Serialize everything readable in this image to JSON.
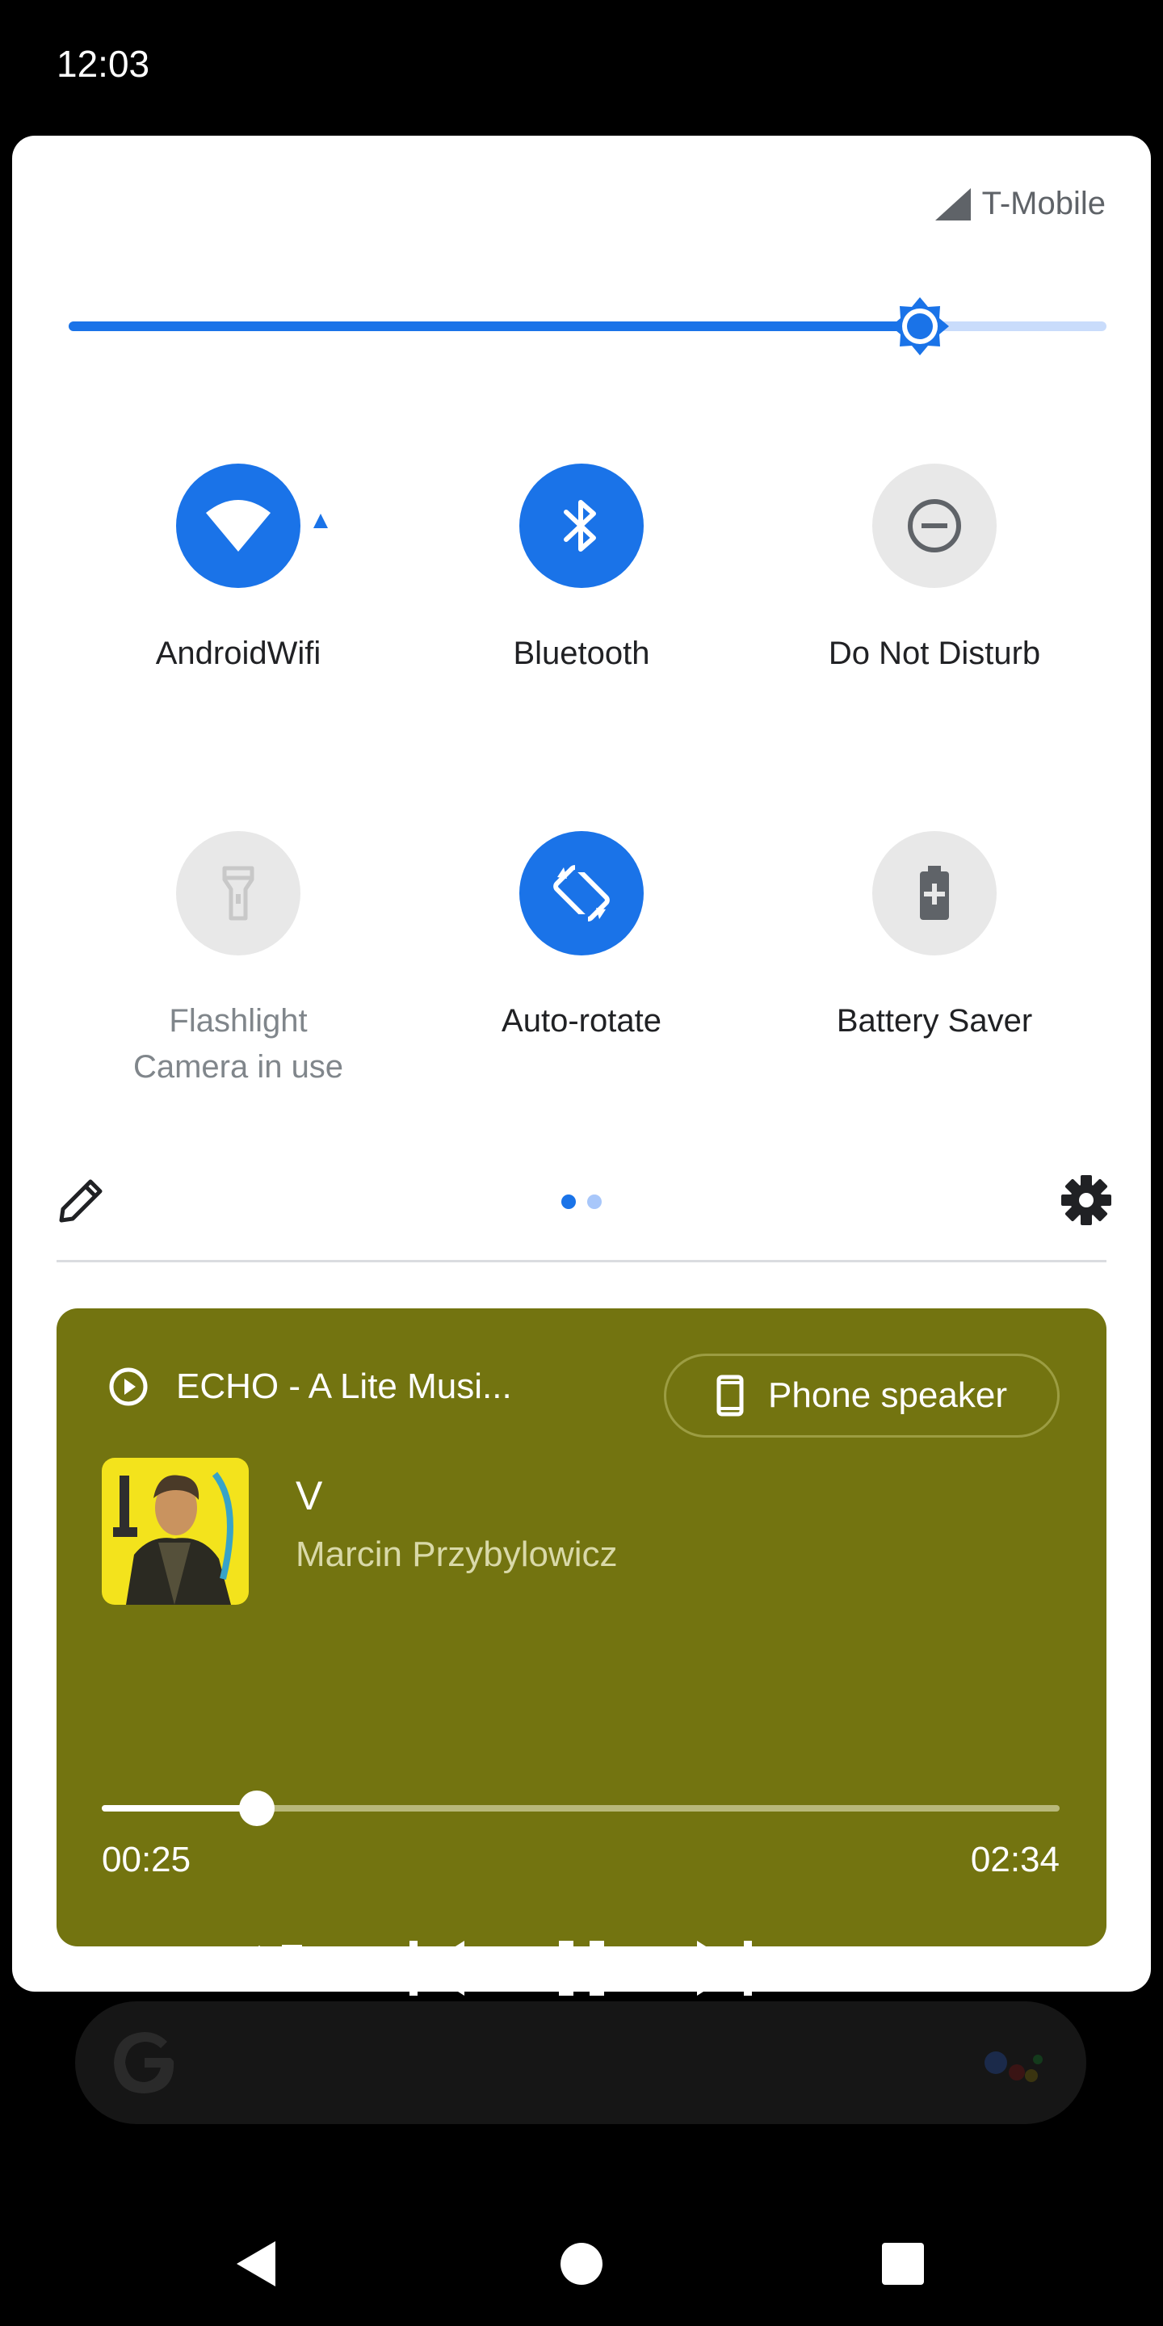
{
  "status_bar": {
    "time": "12:03"
  },
  "quick_settings": {
    "carrier": "T-Mobile",
    "brightness_level": 0.82,
    "tiles": [
      {
        "label": "AndroidWifi",
        "icon": "wifi-icon",
        "state": "on"
      },
      {
        "label": "Bluetooth",
        "icon": "bluetooth-icon",
        "state": "on"
      },
      {
        "label": "Do Not Disturb",
        "icon": "do-not-disturb-icon",
        "state": "off"
      },
      {
        "label": "Flashlight",
        "sublabel": "Camera in use",
        "icon": "flashlight-icon",
        "state": "unavailable"
      },
      {
        "label": "Auto-rotate",
        "icon": "auto-rotate-icon",
        "state": "on"
      },
      {
        "label": "Battery Saver",
        "icon": "battery-saver-icon",
        "state": "off"
      }
    ],
    "page_indicator": {
      "pages": 2,
      "current": 1
    }
  },
  "media": {
    "app_name": "ECHO - A Lite Musi...",
    "output_device": "Phone speaker",
    "title": "V",
    "artist": "Marcin Przybylowicz",
    "elapsed": "00:25",
    "duration": "02:34",
    "progress": 0.162,
    "controls": [
      "shuffle-icon",
      "previous-icon",
      "pause-icon",
      "next-icon",
      "close-icon"
    ]
  },
  "colors": {
    "accent": "#1a73e8",
    "media_background": "#737410",
    "panel_background": "#ffffff",
    "tile_off": "#e8e8e8"
  }
}
